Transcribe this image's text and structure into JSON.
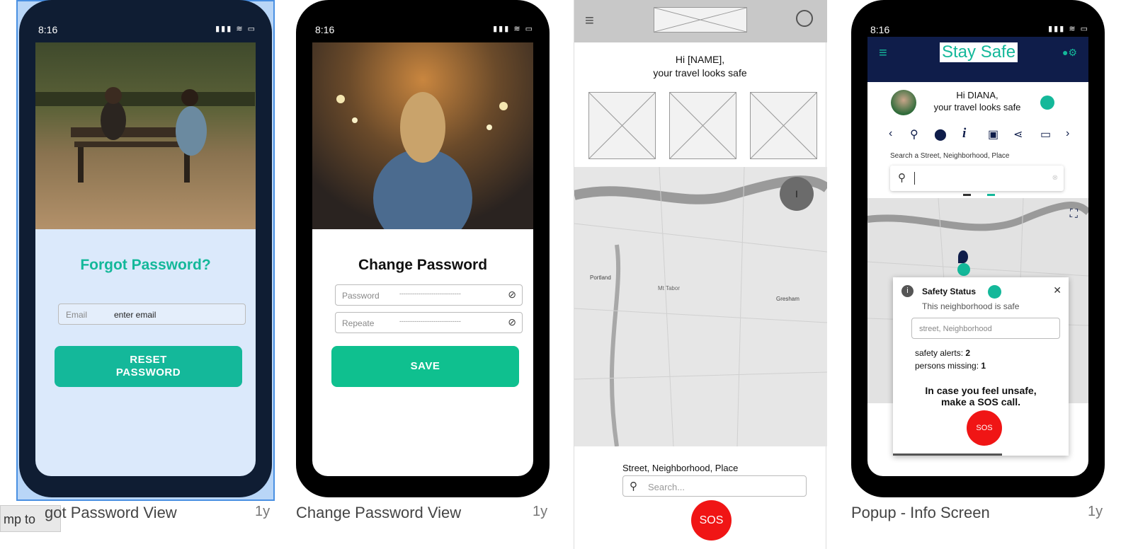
{
  "cards": [
    {
      "caption": "got Password View",
      "age": "1y"
    },
    {
      "caption": "Change Password View",
      "age": "1y"
    },
    {
      "caption": "Popup - Info Screen",
      "age": "1y"
    }
  ],
  "jump_to": "mp to",
  "status": {
    "time": "8:16",
    "icons": "▮▮▮ ≋ ▭"
  },
  "forgot": {
    "title": "Forgot Password?",
    "email_label": "Email",
    "email_placeholder": "enter email",
    "button_line1": "RESET",
    "button_line2": "PASSWORD"
  },
  "change": {
    "title": "Change Password",
    "password_label": "Password",
    "password_value": "-----------------------------",
    "repeat_label": "Repeate",
    "repeat_value": "-----------------------------",
    "save": "SAVE"
  },
  "wire": {
    "greeting1": "Hi [NAME],",
    "greeting2": "your travel looks safe",
    "map_pin": "I",
    "map_labels": [
      "Portland",
      "Gresham",
      "Mt Tabor"
    ],
    "search_label": "Street, Neighborhood, Place",
    "search_placeholder": "Search...",
    "sos": "SOS"
  },
  "popup": {
    "app_title": "Stay Safe",
    "greeting1": "Hi DIANA,",
    "greeting2": "your travel looks safe",
    "search_label": "Search a Street, Neighborhood, Place",
    "info_icon": "i",
    "safety_title": "Safety Status",
    "safety_sub": "This neighborhood is safe",
    "field_placeholder": "street, Neighborhood",
    "alerts_label": "safety alerts:",
    "alerts_value": "2",
    "missing_label": "persons missing:",
    "missing_value": "1",
    "cta1": "In case you feel unsafe,",
    "cta2": "make a SOS call.",
    "sos": "SOS",
    "close": "✕"
  },
  "colors": {
    "accent": "#14b89a",
    "navy": "#0f1d4a",
    "sos": "#f01515"
  }
}
